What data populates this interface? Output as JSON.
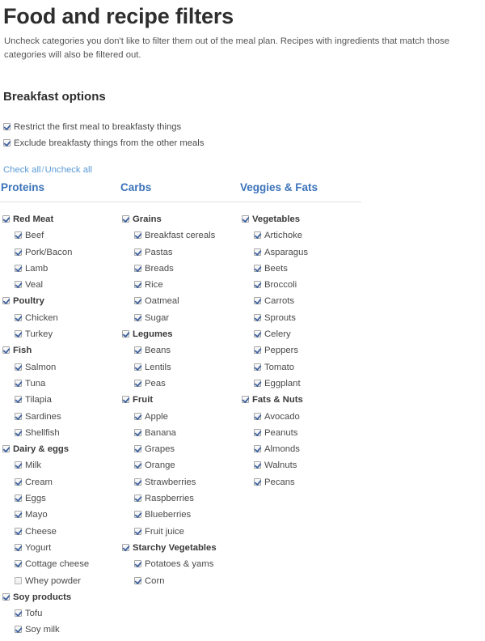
{
  "header": {
    "title": "Food and recipe filters",
    "intro": "Uncheck categories you don't like to filter them out of the meal plan. Recipes with ingredients that match those categories will also be filtered out."
  },
  "breakfast": {
    "title": "Breakfast options",
    "options": [
      {
        "label": "Restrict the first meal to breakfasty things",
        "checked": true
      },
      {
        "label": "Exclude breakfasty things from the other meals",
        "checked": true
      }
    ]
  },
  "bulk_actions": {
    "check_all": "Check all",
    "separator": "/",
    "uncheck_all": "Uncheck all"
  },
  "colors": {
    "column_header": "#3b73b9",
    "link": "#5b9bd5",
    "checkmark": "#3a5f9e",
    "divider": "#e2e2e2",
    "text": "#4a4a4a"
  },
  "columns": [
    {
      "header": "Proteins",
      "items": [
        {
          "label": "Red Meat",
          "checked": true,
          "group": true
        },
        {
          "label": "Beef",
          "checked": true,
          "group": false
        },
        {
          "label": "Pork/Bacon",
          "checked": true,
          "group": false
        },
        {
          "label": "Lamb",
          "checked": true,
          "group": false
        },
        {
          "label": "Veal",
          "checked": true,
          "group": false
        },
        {
          "label": "Poultry",
          "checked": true,
          "group": true
        },
        {
          "label": "Chicken",
          "checked": true,
          "group": false
        },
        {
          "label": "Turkey",
          "checked": true,
          "group": false
        },
        {
          "label": "Fish",
          "checked": true,
          "group": true
        },
        {
          "label": "Salmon",
          "checked": true,
          "group": false
        },
        {
          "label": "Tuna",
          "checked": true,
          "group": false
        },
        {
          "label": "Tilapia",
          "checked": true,
          "group": false
        },
        {
          "label": "Sardines",
          "checked": true,
          "group": false
        },
        {
          "label": "Shellfish",
          "checked": true,
          "group": false
        },
        {
          "label": "Dairy & eggs",
          "checked": true,
          "group": true
        },
        {
          "label": "Milk",
          "checked": true,
          "group": false
        },
        {
          "label": "Cream",
          "checked": true,
          "group": false
        },
        {
          "label": "Eggs",
          "checked": true,
          "group": false
        },
        {
          "label": "Mayo",
          "checked": true,
          "group": false
        },
        {
          "label": "Cheese",
          "checked": true,
          "group": false
        },
        {
          "label": "Yogurt",
          "checked": true,
          "group": false
        },
        {
          "label": "Cottage cheese",
          "checked": true,
          "group": false
        },
        {
          "label": "Whey powder",
          "checked": false,
          "group": false
        },
        {
          "label": "Soy products",
          "checked": true,
          "group": true
        },
        {
          "label": "Tofu",
          "checked": true,
          "group": false
        },
        {
          "label": "Soy milk",
          "checked": true,
          "group": false
        }
      ]
    },
    {
      "header": "Carbs",
      "items": [
        {
          "label": "Grains",
          "checked": true,
          "group": true
        },
        {
          "label": "Breakfast cereals",
          "checked": true,
          "group": false
        },
        {
          "label": "Pastas",
          "checked": true,
          "group": false
        },
        {
          "label": "Breads",
          "checked": true,
          "group": false
        },
        {
          "label": "Rice",
          "checked": true,
          "group": false
        },
        {
          "label": "Oatmeal",
          "checked": true,
          "group": false
        },
        {
          "label": "Sugar",
          "checked": true,
          "group": false
        },
        {
          "label": "Legumes",
          "checked": true,
          "group": true
        },
        {
          "label": "Beans",
          "checked": true,
          "group": false
        },
        {
          "label": "Lentils",
          "checked": true,
          "group": false
        },
        {
          "label": "Peas",
          "checked": true,
          "group": false
        },
        {
          "label": "Fruit",
          "checked": true,
          "group": true
        },
        {
          "label": "Apple",
          "checked": true,
          "group": false
        },
        {
          "label": "Banana",
          "checked": true,
          "group": false
        },
        {
          "label": "Grapes",
          "checked": true,
          "group": false
        },
        {
          "label": "Orange",
          "checked": true,
          "group": false
        },
        {
          "label": "Strawberries",
          "checked": true,
          "group": false
        },
        {
          "label": "Raspberries",
          "checked": true,
          "group": false
        },
        {
          "label": "Blueberries",
          "checked": true,
          "group": false
        },
        {
          "label": "Fruit juice",
          "checked": true,
          "group": false
        },
        {
          "label": "Starchy Vegetables",
          "checked": true,
          "group": true
        },
        {
          "label": "Potatoes & yams",
          "checked": true,
          "group": false
        },
        {
          "label": "Corn",
          "checked": true,
          "group": false
        }
      ]
    },
    {
      "header": "Veggies & Fats",
      "items": [
        {
          "label": "Vegetables",
          "checked": true,
          "group": true
        },
        {
          "label": "Artichoke",
          "checked": true,
          "group": false
        },
        {
          "label": "Asparagus",
          "checked": true,
          "group": false
        },
        {
          "label": "Beets",
          "checked": true,
          "group": false
        },
        {
          "label": "Broccoli",
          "checked": true,
          "group": false
        },
        {
          "label": "Carrots",
          "checked": true,
          "group": false
        },
        {
          "label": "Sprouts",
          "checked": true,
          "group": false
        },
        {
          "label": "Celery",
          "checked": true,
          "group": false
        },
        {
          "label": "Peppers",
          "checked": true,
          "group": false
        },
        {
          "label": "Tomato",
          "checked": true,
          "group": false
        },
        {
          "label": "Eggplant",
          "checked": true,
          "group": false
        },
        {
          "label": "Fats & Nuts",
          "checked": true,
          "group": true
        },
        {
          "label": "Avocado",
          "checked": true,
          "group": false
        },
        {
          "label": "Peanuts",
          "checked": true,
          "group": false
        },
        {
          "label": "Almonds",
          "checked": true,
          "group": false
        },
        {
          "label": "Walnuts",
          "checked": true,
          "group": false
        },
        {
          "label": "Pecans",
          "checked": true,
          "group": false
        }
      ]
    }
  ]
}
